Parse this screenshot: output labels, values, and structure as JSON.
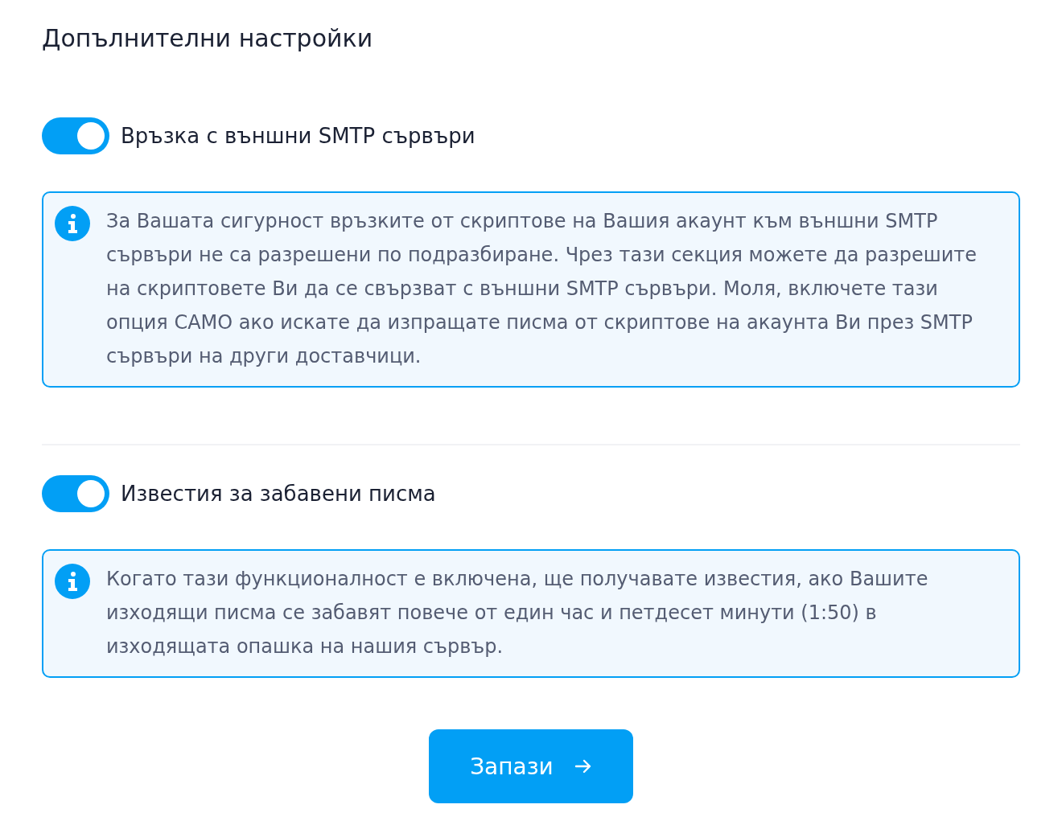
{
  "title": "Допълнителни настройки",
  "settings": [
    {
      "label": "Връзка с външни SMTP сървъри",
      "on": true,
      "info": "За Вашата сигурност връзките от скриптове на Вашия акаунт към външни SMTP сървъри не са разрешени по подразбиране. Чрез тази секция можете да разрешите на скриптовете Ви да се свързват с външни SMTP сървъри. Моля, включете тази опция САМО ако искате да изпращате писма от скриптове на акаунта Ви през SMTP сървъри на други доставчици."
    },
    {
      "label": "Известия за забавени писма",
      "on": true,
      "info": "Когато тази функционалност е включена, ще получавате известия, ако Вашите изходящи писма се забавят повече от един час и петдесет минути (1:50) в изходящата опашка на нашия сървър."
    }
  ],
  "save_button": "Запази"
}
